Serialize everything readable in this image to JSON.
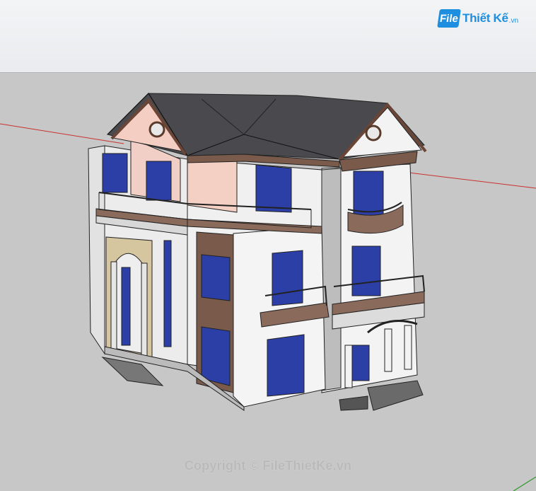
{
  "app": {
    "name": "SketchUp model viewport"
  },
  "branding": {
    "logo_box": "File",
    "logo_text": "Thiết Kế",
    "logo_suffix": ".vn"
  },
  "watermark": {
    "text": "Copyright © FileThietKe.vn"
  },
  "colors": {
    "ground": "#c7c7c7",
    "toolbar": "#eceef1",
    "roof": "#4a4a4e",
    "wall": "#f1f1f1",
    "accent_pink": "#f2cfc6",
    "window_glass": "#2c3fa6",
    "trim_brown": "#7a5a4a",
    "axis_red": "#c8312f",
    "axis_green": "#2e9a2e",
    "logo_blue": "#1d8ee0"
  },
  "icons": {
    "axis": "axis-lines-icon",
    "model": "house-3d-model-icon"
  }
}
